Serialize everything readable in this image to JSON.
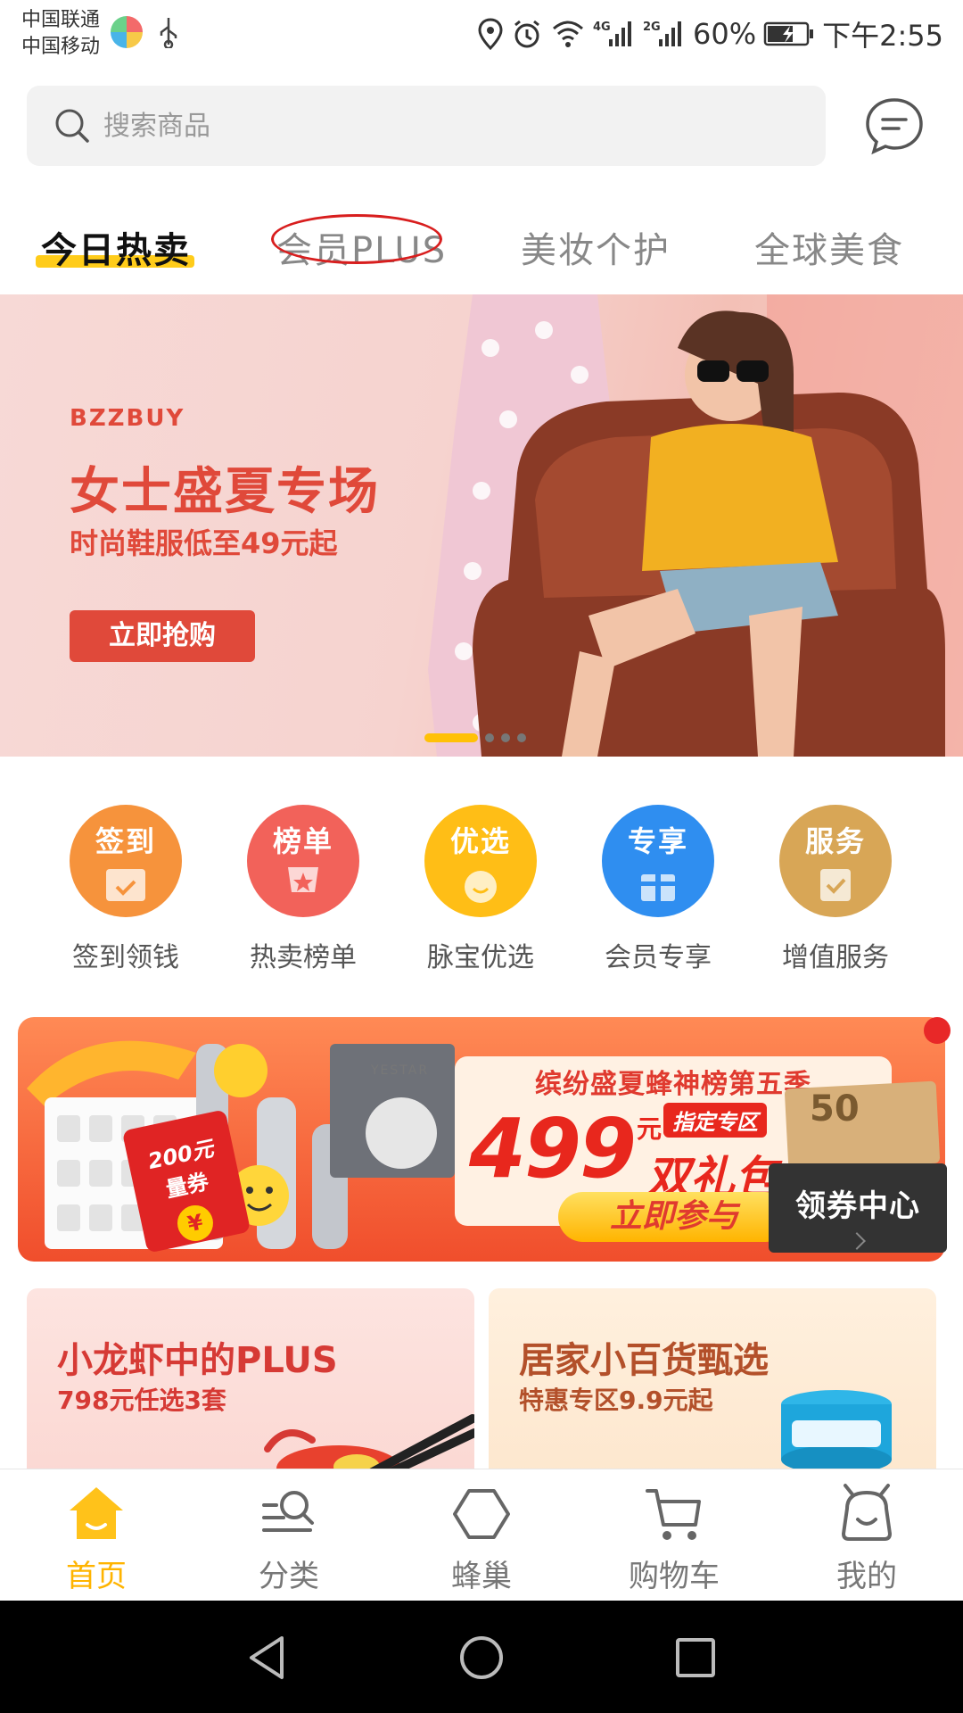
{
  "status_bar": {
    "carrier_1": "中国联通",
    "carrier_2": "中国移动",
    "network_1": "4G",
    "network_2": "2G",
    "battery": "60%",
    "time": "下午2:55"
  },
  "search": {
    "placeholder": "搜索商品"
  },
  "tabs": [
    {
      "label": "今日热卖",
      "active": true
    },
    {
      "label": "会员PLUS",
      "active": false
    },
    {
      "label": "美妆个护",
      "active": false
    },
    {
      "label": "全球美食",
      "active": false
    }
  ],
  "hero_banner": {
    "brand": "BZZBUY",
    "title": "女士盛夏专场",
    "subtitle": "时尚鞋服低至49元起",
    "button": "立即抢购",
    "slide_count": 4,
    "active_slide": 1
  },
  "quick_links": [
    {
      "badge": "签到",
      "label": "签到领钱",
      "color": "#f6933c"
    },
    {
      "badge": "榜单",
      "label": "热卖榜单",
      "color": "#f2625a"
    },
    {
      "badge": "优选",
      "label": "脉宝优选",
      "color": "#ffbe16"
    },
    {
      "badge": "专享",
      "label": "会员专享",
      "color": "#2f8ef0"
    },
    {
      "badge": "服务",
      "label": "增值服务",
      "color": "#d8a656"
    }
  ],
  "promo_banner": {
    "headline": "缤纷盛夏蜂神榜第五季",
    "price": "499",
    "price_unit": "元",
    "zone_tag": "指定专区",
    "gift": "双礼包",
    "join_button": "立即参与",
    "coupon_center": "领券中心",
    "coupon_value": "50",
    "red_packet_amount": "200元",
    "red_packet_label": "量券",
    "red_packet_symbol": "¥",
    "product_brand": "YESTAR"
  },
  "cards": [
    {
      "title": "小龙虾中的PLUS",
      "subtitle": "798元任选3套"
    },
    {
      "title": "居家小百货甄选",
      "subtitle": "特惠专区9.9元起"
    }
  ],
  "bottom_nav": [
    {
      "label": "首页",
      "icon": "home-icon",
      "active": true
    },
    {
      "label": "分类",
      "icon": "category-icon",
      "active": false
    },
    {
      "label": "蜂巢",
      "icon": "hive-icon",
      "active": false
    },
    {
      "label": "购物车",
      "icon": "cart-icon",
      "active": false
    },
    {
      "label": "我的",
      "icon": "profile-icon",
      "active": false
    }
  ],
  "colors": {
    "accent": "#ffcc1a",
    "active_nav": "#ffb400",
    "promo_red": "#e8271d",
    "hero_red": "#e0493a"
  }
}
